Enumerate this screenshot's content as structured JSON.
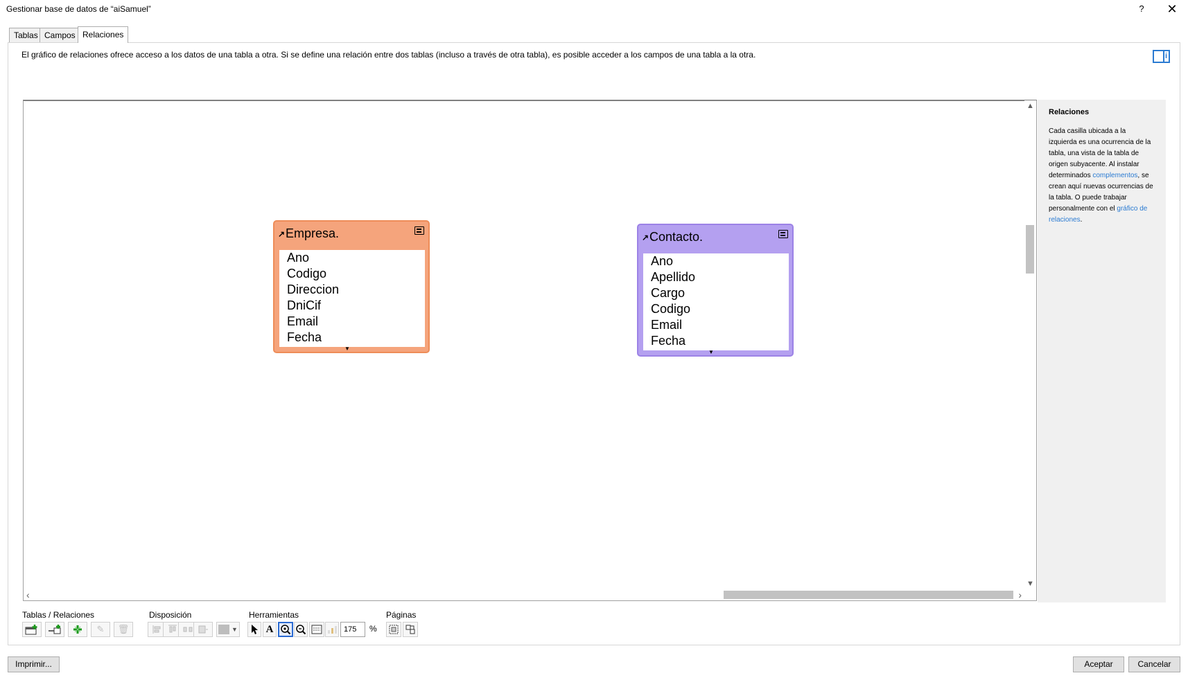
{
  "window": {
    "title": "Gestionar base de datos de “aiSamuel”",
    "help_label": "?",
    "close_label": "✕"
  },
  "tabs": [
    {
      "label": "Tablas",
      "active": false
    },
    {
      "label": "Campos",
      "active": false
    },
    {
      "label": "Relaciones",
      "active": true
    }
  ],
  "description": "El gráfico de relaciones ofrece acceso a los datos de una tabla a otra. Si se define una relación entre dos tablas (incluso a través de otra tabla), es posible acceder a los campos de una tabla a la otra.",
  "graph": {
    "tables": [
      {
        "name": "Empresa.",
        "color": "#f5a47c",
        "fields": [
          "Ano",
          "Codigo",
          "Direccion",
          "DniCif",
          "Email",
          "Fecha"
        ]
      },
      {
        "name": "Contacto.",
        "color": "#b4a0f0",
        "fields": [
          "Ano",
          "Apellido",
          "Cargo",
          "Codigo",
          "Email",
          "Fecha"
        ]
      }
    ]
  },
  "side_panel": {
    "title": "Relaciones",
    "text_1": "Cada casilla ubicada a la izquierda es una ocurrencia de la tabla, una vista de la tabla de origen subyacente. Al instalar determinados",
    "link_1": "complementos",
    "text_2": ", se crean aquí nuevas ocurrencias de la tabla. O puede trabajar personalmente con el",
    "link_2": "gráfico de relaciones",
    "text_3": "."
  },
  "toolbar": {
    "groups": {
      "tables_relations": "Tablas / Relaciones",
      "layout": "Disposición",
      "tools": "Herramientas",
      "pages": "Páginas"
    },
    "zoom_value": "175",
    "zoom_unit": "%"
  },
  "buttons": {
    "print": "Imprimir...",
    "ok": "Aceptar",
    "cancel": "Cancelar"
  },
  "colors": {
    "accent": "#2b7bd2",
    "empresa_header": "#f5a47c",
    "contacto_header": "#b4a0f0"
  }
}
